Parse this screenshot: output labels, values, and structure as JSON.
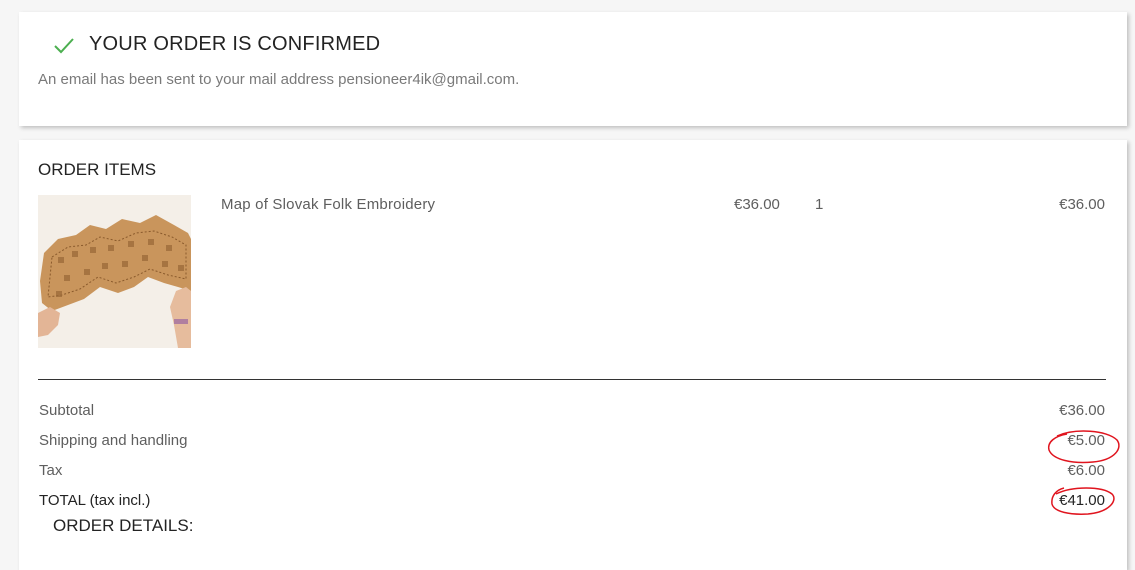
{
  "confirmation": {
    "title": "YOUR ORDER IS CONFIRMED",
    "email_message": "An email has been sent to your mail address pensioneer4ik@gmail.com.",
    "check_color": "#4caf50"
  },
  "order_items": {
    "title": "ORDER ITEMS",
    "items": [
      {
        "name": "Map of Slovak Folk Embroidery",
        "unit_price": "€36.00",
        "quantity": "1",
        "total": "€36.00",
        "image": "embroidery-map-photo"
      }
    ]
  },
  "summary": {
    "rows": [
      {
        "label": "Subtotal",
        "value": "€36.00"
      },
      {
        "label": "Shipping and handling",
        "value": "€5.00"
      },
      {
        "label": "Tax",
        "value": "€6.00"
      },
      {
        "label": "TOTAL (tax incl.)",
        "value": "€41.00"
      }
    ]
  },
  "order_details": {
    "title": "ORDER DETAILS:"
  },
  "annotation_color": "#e0141e"
}
